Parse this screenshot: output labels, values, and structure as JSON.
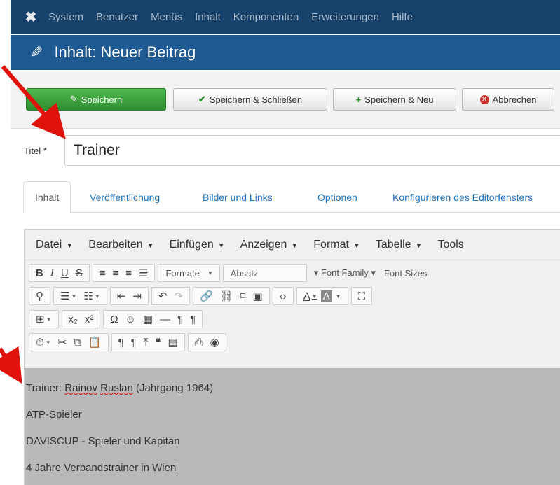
{
  "nav": {
    "items": [
      "System",
      "Benutzer",
      "Menüs",
      "Inhalt",
      "Komponenten",
      "Erweiterungen",
      "Hilfe"
    ]
  },
  "header": {
    "title": "Inhalt: Neuer Beitrag"
  },
  "toolbar": {
    "save": "Speichern",
    "save_close": "Speichern & Schließen",
    "save_new": "Speichern & Neu",
    "cancel": "Abbrechen"
  },
  "form": {
    "title_label": "Titel *",
    "title_value": "Trainer"
  },
  "tabs": [
    "Inhalt",
    "Veröffentlichung",
    "Bilder und Links",
    "Optionen",
    "Konfigurieren des Editorfensters"
  ],
  "editor": {
    "menus": [
      "Datei",
      "Bearbeiten",
      "Einfügen",
      "Anzeigen",
      "Format",
      "Tabelle",
      "Tools"
    ],
    "formats_label": "Formate",
    "block_label": "Absatz",
    "font_family": "Font Family",
    "font_sizes": "Font Sizes",
    "content": {
      "line1_prefix": "Trainer: ",
      "line1_name1": "Rainov",
      "line1_name2": "Ruslan",
      "line1_suffix": " (Jahrgang 1964)",
      "line2": "ATP-Spieler",
      "line3": "DAVISCUP - Spieler und Kapitän",
      "line4": "4 Jahre Verbandstrainer in Wien"
    }
  },
  "colors": {
    "nav_bg": "#17426b",
    "header_bg": "#1f5a93",
    "save_green": "#3aa23a",
    "link_blue": "#1e73be",
    "arrow_red": "#e0120c",
    "content_bg": "#b9b9b9"
  }
}
